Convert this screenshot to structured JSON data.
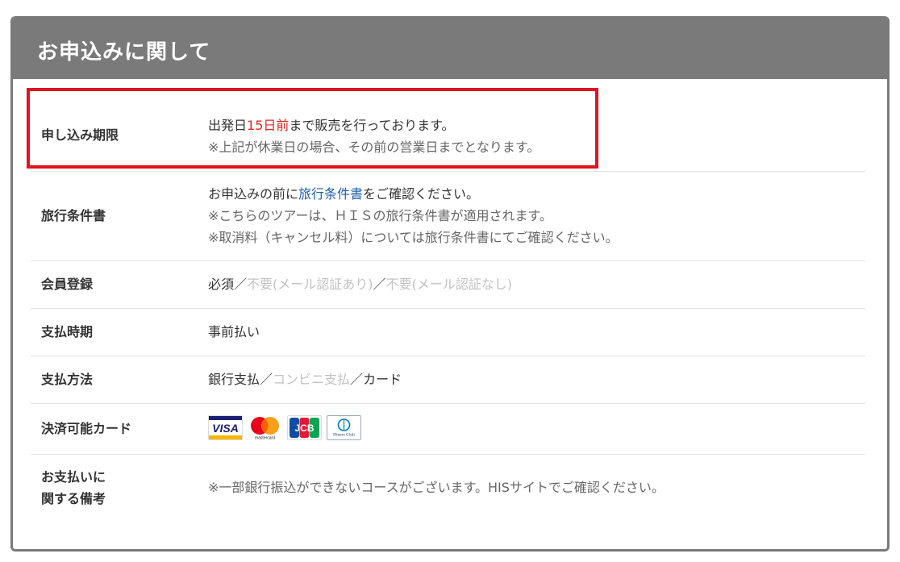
{
  "header": {
    "title": "お申込みに関して"
  },
  "rows": [
    {
      "label": "申し込み期限",
      "line1_pre": "出発日",
      "line1_red": "15日前",
      "line1_post": "まで販売を行っております。",
      "line2": "※上記が休業日の場合、その前の営業日までとなります。"
    },
    {
      "label": "旅行条件書",
      "line1_pre": "お申込みの前に",
      "line1_link": "旅行条件書",
      "line1_post": "をご確認ください。",
      "line2": "※こちらのツアーは、ＨＩＳの旅行条件書が適用されます。",
      "line3": "※取消料（キャンセル料）については旅行条件書にてご確認ください。"
    },
    {
      "label": "会員登録",
      "opt1": "必須",
      "sep1": "／",
      "opt2": "不要(メール認証あり)",
      "sep2": "／",
      "opt3": "不要(メール認証なし)"
    },
    {
      "label": "支払時期",
      "value": "事前払い"
    },
    {
      "label": "支払方法",
      "opt1": "銀行支払",
      "sep1": "／",
      "opt2": "コンビニ支払",
      "sep2": "／",
      "opt3": "カード"
    },
    {
      "label": "決済可能カード",
      "cards": [
        {
          "name": "VISA",
          "icon": "visa-icon"
        },
        {
          "name": "mastercard",
          "icon": "mastercard-icon"
        },
        {
          "name": "JCB",
          "icon": "jcb-icon"
        },
        {
          "name": "Diners Club",
          "icon": "diners-club-icon"
        }
      ]
    },
    {
      "label_line1": "お支払いに",
      "label_line2": "関する備考",
      "value": "※一部銀行振込ができないコースがございます。HISサイトでご確認ください。"
    }
  ],
  "colors": {
    "header_bg": "#7a7a7a",
    "highlight_border": "#e0141e",
    "accent_red": "#e0241e",
    "link": "#1e5fa8",
    "disabled": "#c2c2c2"
  }
}
